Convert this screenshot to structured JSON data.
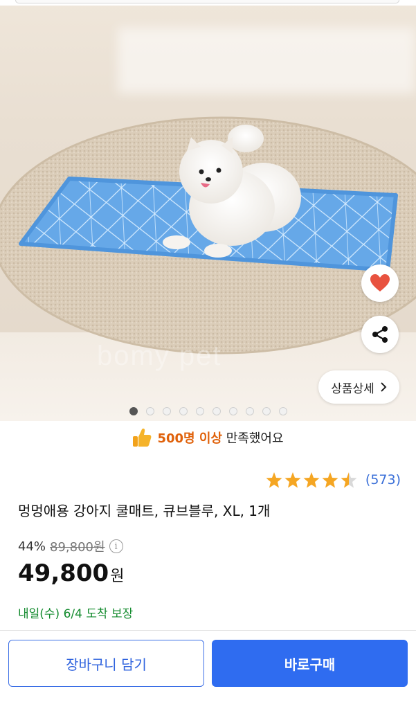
{
  "hero": {
    "watermark": "bomy pet",
    "heart_icon": "heart-icon",
    "share_icon": "share-icon",
    "detail_button": "상품상세",
    "carousel_total": 10,
    "carousel_active": 1
  },
  "satisfaction": {
    "highlight": "500명 이상",
    "rest": " 만족했어요",
    "icon": "thumbs-up-icon"
  },
  "rating": {
    "stars": 4.5,
    "count": "(573)"
  },
  "product": {
    "title": "멍멍애용 강아지 쿨매트, 큐브블루, XL, 1개",
    "discount": "44%",
    "original_price": "89,800원",
    "price": "49,800",
    "currency": "원",
    "delivery": "내일(수) 6/4 도착 보장"
  },
  "actions": {
    "cart": "장바구니 담기",
    "buy": "바로구매"
  },
  "colors": {
    "accent": "#2f6cf0",
    "delivery": "#118a2c",
    "highlight": "#e0610a",
    "star": "#f5a623"
  }
}
